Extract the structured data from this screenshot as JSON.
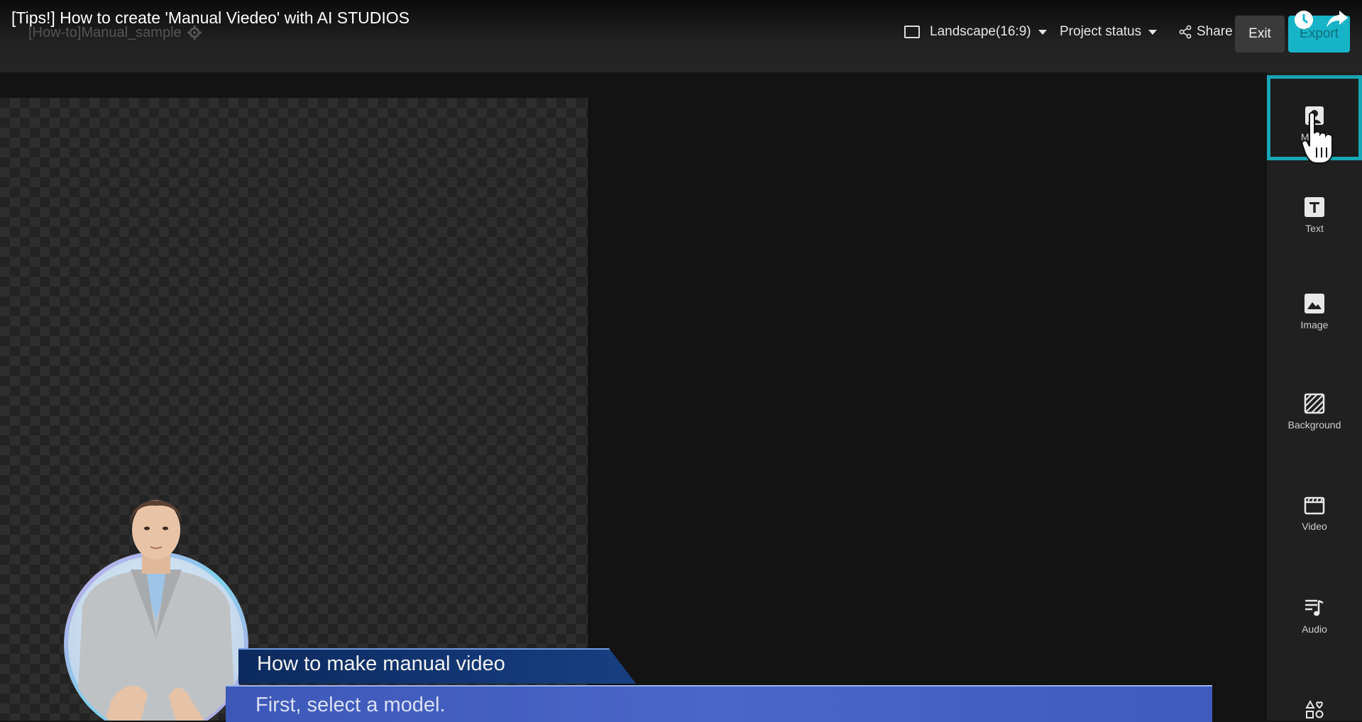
{
  "video": {
    "title": "[Tips!] How to create 'Manual Viedeo' with AI STUDIOS"
  },
  "header": {
    "project_name": "[How-to]Manual_sample",
    "aspect_ratio": "Landscape(16:9)",
    "project_status": "Project status",
    "share_label": "Share",
    "exit_label": "Exit",
    "export_label": "Export",
    "accent_color": "#17b4c8"
  },
  "tools": [
    {
      "label": "Model",
      "icon": "model-icon",
      "selected": true
    },
    {
      "label": "Text",
      "icon": "text-icon"
    },
    {
      "label": "Image",
      "icon": "image-icon"
    },
    {
      "label": "Background",
      "icon": "background-icon"
    },
    {
      "label": "Video",
      "icon": "video-icon"
    },
    {
      "label": "Audio",
      "icon": "audio-icon"
    }
  ],
  "overlay": {
    "title": "How to make manual video",
    "subtitle": "First, select a model."
  }
}
